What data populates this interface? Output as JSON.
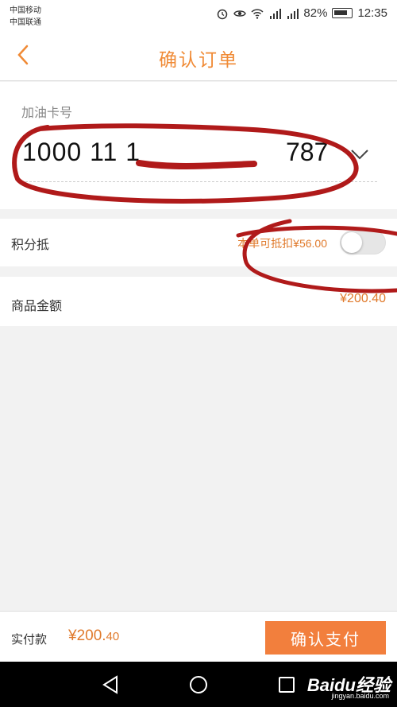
{
  "status_bar": {
    "carrier1": "中国移动",
    "carrier2": "中国联通",
    "battery": "82%",
    "time": "12:35"
  },
  "header": {
    "title": "确认订单"
  },
  "card": {
    "label": "加油卡号",
    "number_prefix": "1000 11 1",
    "number_suffix": "787"
  },
  "points": {
    "label": "积分抵",
    "hint": "本单可抵扣¥56.00",
    "enabled": false
  },
  "product": {
    "label": "商品金额",
    "amount": "¥200.40"
  },
  "footer": {
    "pay_label": "实付款",
    "pay_amount_main": "¥200.",
    "pay_amount_cents": "40",
    "confirm_label": "确认支付"
  },
  "watermark": {
    "brand": "Baidu经验",
    "url": "jingyan.baidu.com"
  },
  "colors": {
    "accent": "#f08a35",
    "button": "#f27f3d",
    "annotation": "#b01a1a"
  }
}
